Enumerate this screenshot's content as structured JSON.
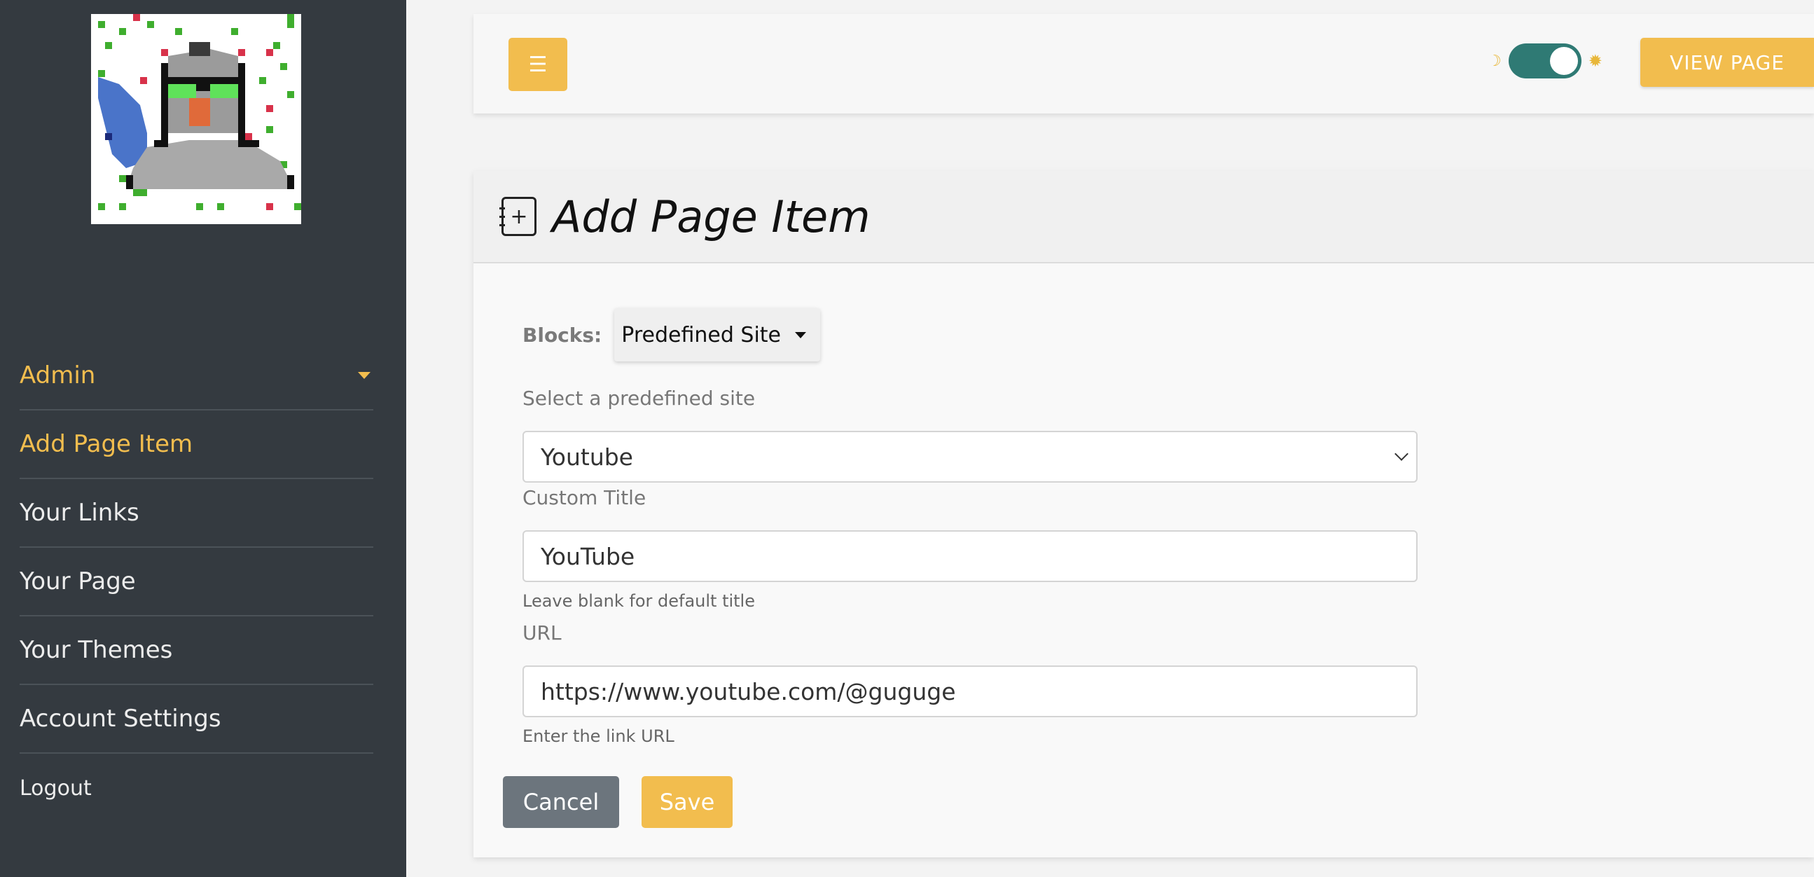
{
  "sidebar": {
    "avatar_alt": "pixel-art avatar",
    "items": [
      {
        "label": "Admin"
      },
      {
        "label": "Add Page Item"
      },
      {
        "label": "Your Links"
      },
      {
        "label": "Your Page"
      },
      {
        "label": "Your Themes"
      },
      {
        "label": "Account Settings"
      },
      {
        "label": "Logout"
      }
    ]
  },
  "topbar": {
    "menu_icon": "☰",
    "theme_toggle": {
      "state": "on",
      "left_icon": "☽",
      "right_icon": "✹"
    },
    "view_page_label": "VIEW PAGE"
  },
  "card": {
    "title": "Add Page Item",
    "blocks_label": "Blocks:",
    "blocks_value": "Predefined Site",
    "predefined_label": "Select a predefined site",
    "predefined_value": "Youtube",
    "custom_title_label": "Custom Title",
    "custom_title_value": "YouTube",
    "custom_title_help": "Leave blank for default title",
    "url_label": "URL",
    "url_value": "https://www.youtube.com/@guguge",
    "url_help": "Enter the link URL",
    "cancel_label": "Cancel",
    "save_label": "Save"
  },
  "colors": {
    "accent": "#f2bd4e",
    "sidebar_bg": "#343a40",
    "toggle_on": "#2f7a74",
    "cancel_bg": "#6c757d"
  }
}
